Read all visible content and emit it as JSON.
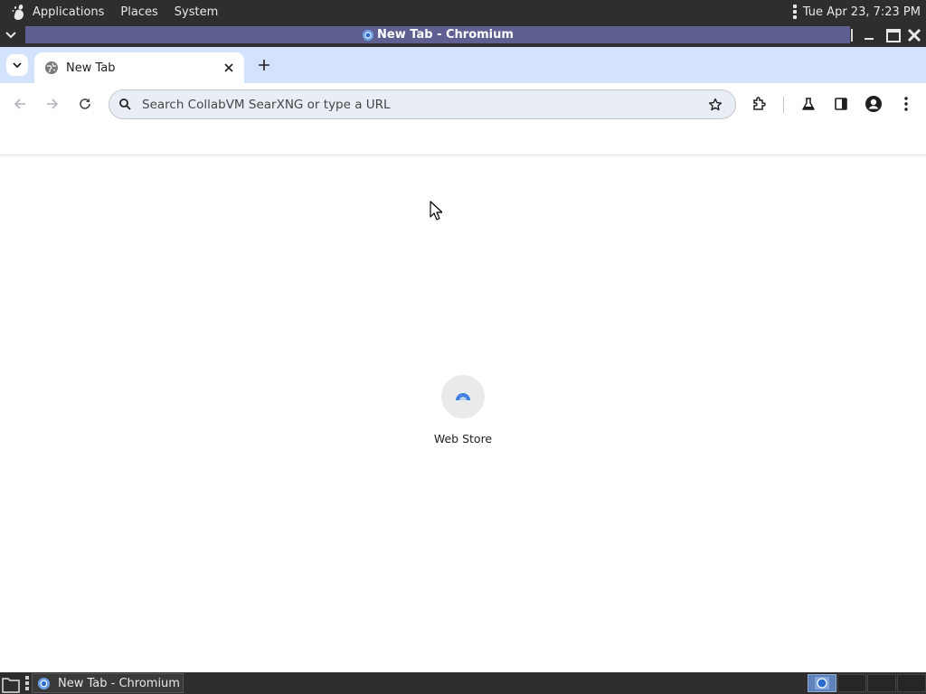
{
  "top_panel": {
    "menus": [
      "Applications",
      "Places",
      "System"
    ],
    "clock": "Tue Apr 23,  7:23 PM",
    "icons": [
      "gnome-foot-icon",
      "panel-handle-icon"
    ]
  },
  "window": {
    "title": "New Tab - Chromium",
    "accent": "#5f5f92"
  },
  "browser": {
    "tab": {
      "title": "New Tab"
    },
    "omnibox": {
      "placeholder": "Search CollabVM SearXNG or type a URL"
    },
    "toolbar_icons": [
      "back-icon",
      "forward-icon",
      "reload-icon",
      "extensions-icon",
      "labs-icon",
      "side-panel-icon",
      "profile-icon",
      "more-menu-icon"
    ],
    "tab_strip_color": "#d3e3fd"
  },
  "new_tab_page": {
    "shortcuts": [
      {
        "label": "Web Store"
      }
    ]
  },
  "taskbar": {
    "task": {
      "label": "New Tab - Chromium"
    }
  }
}
